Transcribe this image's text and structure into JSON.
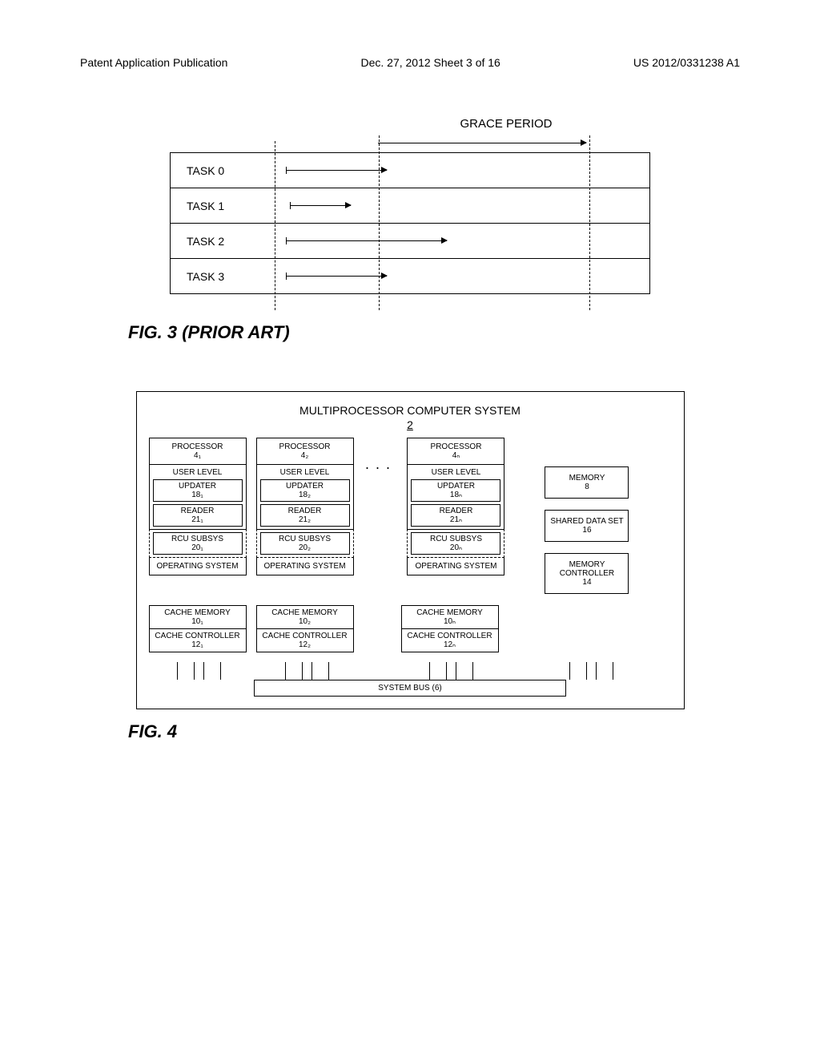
{
  "header": {
    "left": "Patent Application Publication",
    "center": "Dec. 27, 2012  Sheet 3 of 16",
    "right": "US 2012/0331238 A1"
  },
  "fig3": {
    "grace_label": "GRACE PERIOD",
    "tasks": [
      "TASK 0",
      "TASK 1",
      "TASK 2",
      "TASK 3"
    ],
    "caption": "FIG. 3 (PRIOR ART)"
  },
  "fig4": {
    "title": "MULTIPROCESSOR COMPUTER SYSTEM",
    "num": "2",
    "procs": [
      {
        "proc": "PROCESSOR",
        "pn": "4₁",
        "user": "USER LEVEL",
        "upd": "UPDATER",
        "updn": "18₁",
        "rdr": "READER",
        "rdrn": "21₁",
        "rcu": "RCU SUBSYS",
        "rcun": "20₁",
        "os": "OPERATING SYSTEM",
        "cache": "CACHE MEMORY",
        "cachen": "10₁",
        "cc": "CACHE CONTROLLER",
        "ccn": "12₁"
      },
      {
        "proc": "PROCESSOR",
        "pn": "4₂",
        "user": "USER LEVEL",
        "upd": "UPDATER",
        "updn": "18₂",
        "rdr": "READER",
        "rdrn": "21₂",
        "rcu": "RCU SUBSYS",
        "rcun": "20₂",
        "os": "OPERATING SYSTEM",
        "cache": "CACHE MEMORY",
        "cachen": "10₂",
        "cc": "CACHE CONTROLLER",
        "ccn": "12₂"
      },
      {
        "proc": "PROCESSOR",
        "pn": "4ₙ",
        "user": "USER LEVEL",
        "upd": "UPDATER",
        "updn": "18ₙ",
        "rdr": "READER",
        "rdrn": "21ₙ",
        "rcu": "RCU SUBSYS",
        "rcun": "20ₙ",
        "os": "OPERATING SYSTEM",
        "cache": "CACHE MEMORY",
        "cachen": "10ₙ",
        "cc": "CACHE CONTROLLER",
        "ccn": "12ₙ"
      }
    ],
    "mem": "MEMORY",
    "memn": "8",
    "sds": "SHARED DATA SET",
    "sdsn": "16",
    "mc": "MEMORY CONTROLLER",
    "mcn": "14",
    "bus": "SYSTEM BUS (6)",
    "caption": "FIG. 4"
  }
}
